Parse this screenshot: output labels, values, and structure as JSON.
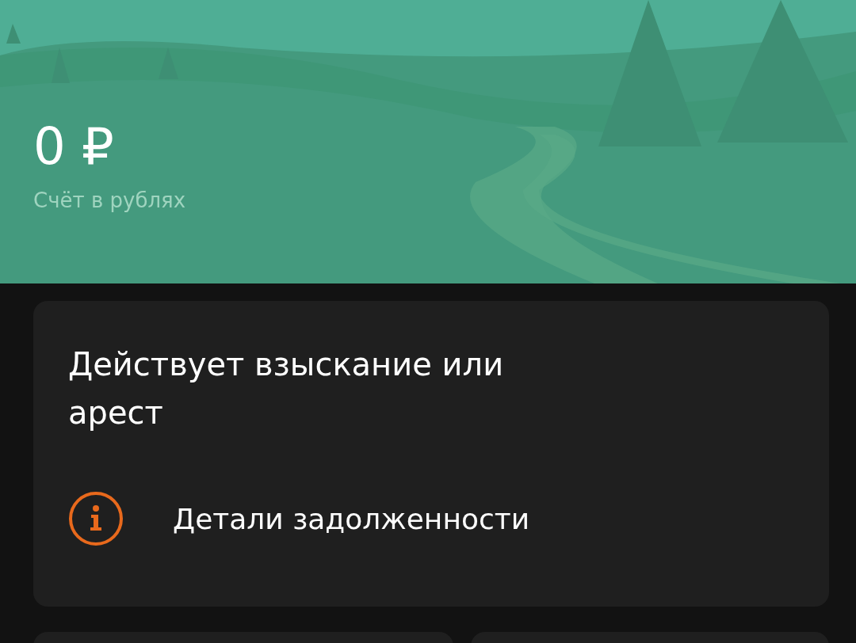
{
  "account": {
    "balance": "0 ₽",
    "label": "Счёт в рублях"
  },
  "notice": {
    "title": "Действует взыскание или арест",
    "link": {
      "label": "Детали задолженности"
    }
  },
  "tiles": [
    {
      "kind": "tile"
    },
    {
      "kind": "tile"
    }
  ]
}
